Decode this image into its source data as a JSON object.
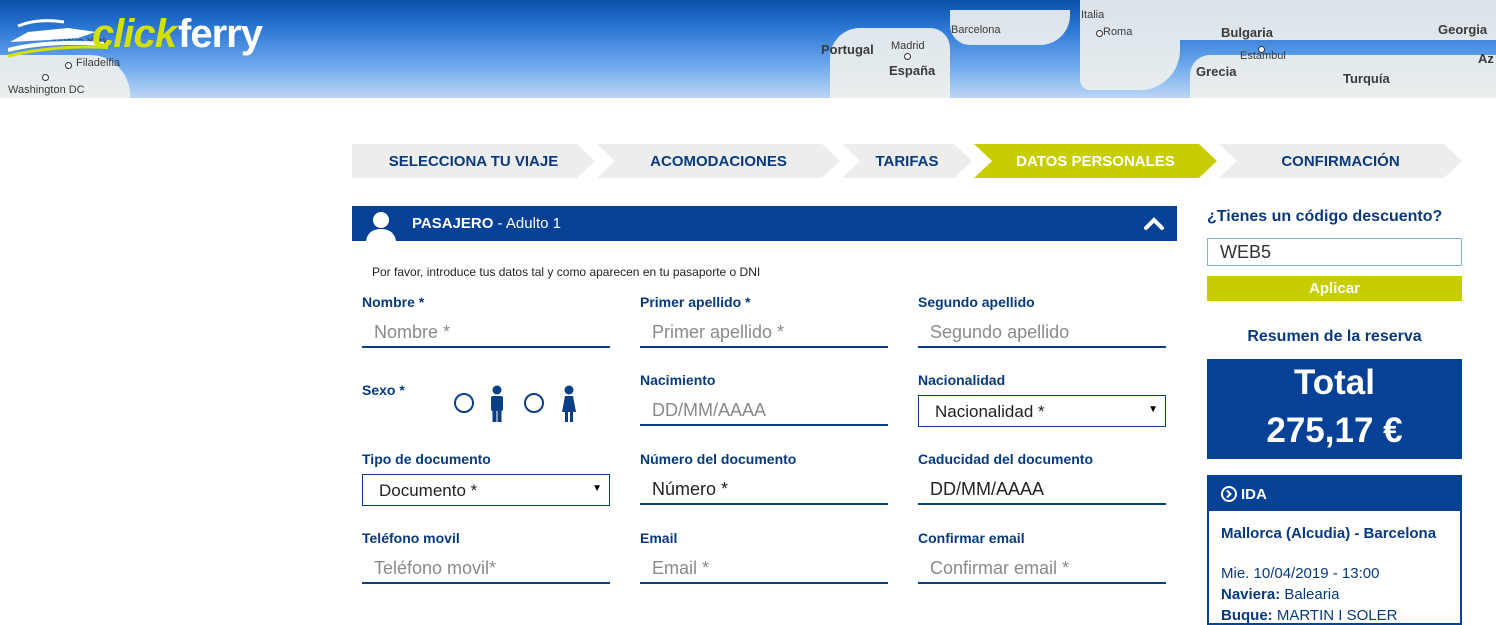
{
  "brand": {
    "logo_part1": "click",
    "logo_part2": "ferry",
    "map_labels": [
      "Nueva York",
      "Filadelfia",
      "Washington DC",
      "Portugal",
      "Madrid",
      "España",
      "Barcelona",
      "Italia",
      "Roma",
      "Bulgaria",
      "Estambul",
      "Grecia",
      "Turquía",
      "Georgia",
      "Az"
    ]
  },
  "steps": [
    {
      "label": "SELECCIONA TU VIAJE",
      "active": false
    },
    {
      "label": "ACOMODACIONES",
      "active": false
    },
    {
      "label": "TARIFAS",
      "active": false
    },
    {
      "label": "DATOS PERSONALES",
      "active": true
    },
    {
      "label": "CONFIRMACIÓN",
      "active": false
    }
  ],
  "passenger": {
    "title_bold": "PASAJERO",
    "title_rest": " - Adulto 1",
    "hint": "Por favor, introduce tus datos tal y como aparecen en tu pasaporte o DNI",
    "fields": {
      "nombre": {
        "label": "Nombre *",
        "placeholder": "Nombre *"
      },
      "apellido1": {
        "label": "Primer apellido *",
        "placeholder": "Primer apellido *"
      },
      "apellido2": {
        "label": "Segundo apellido",
        "placeholder": "Segundo apellido"
      },
      "sexo": {
        "label": "Sexo *"
      },
      "nacimiento": {
        "label": "Nacimiento",
        "placeholder": "DD/MM/AAAA"
      },
      "nacionalidad": {
        "label": "Nacionalidad",
        "value": "Nacionalidad *"
      },
      "tipo_doc": {
        "label": "Tipo de documento",
        "value": "Documento *"
      },
      "num_doc": {
        "label": "Número del documento",
        "value": "Número *"
      },
      "caducidad": {
        "label": "Caducidad del documento",
        "value": "DD/MM/AAAA"
      },
      "telefono": {
        "label": "Teléfono movil",
        "placeholder": "Teléfono movil*"
      },
      "email": {
        "label": "Email",
        "placeholder": "Email *"
      },
      "confirm_email": {
        "label": "Confirmar email",
        "placeholder": "Confirmar email *"
      }
    }
  },
  "promo": {
    "question": "¿Tienes un código descuento?",
    "value": "WEB5",
    "button": "Aplicar"
  },
  "summary": {
    "title": "Resumen de la reserva",
    "total_label": "Total",
    "total_amount": "275,17 €"
  },
  "ida": {
    "title": "IDA",
    "route": "Mallorca (Alcudia) - Barcelona",
    "date": "Mie. 10/04/2019 - 13:00",
    "naviera_label": "Naviera:",
    "naviera_value": "Balearia",
    "buque_label": "Buque:",
    "buque_value": "MARTIN I SOLER"
  },
  "colors": {
    "primary": "#064195",
    "accent": "#c8cd00",
    "step_bg": "#ededed"
  }
}
